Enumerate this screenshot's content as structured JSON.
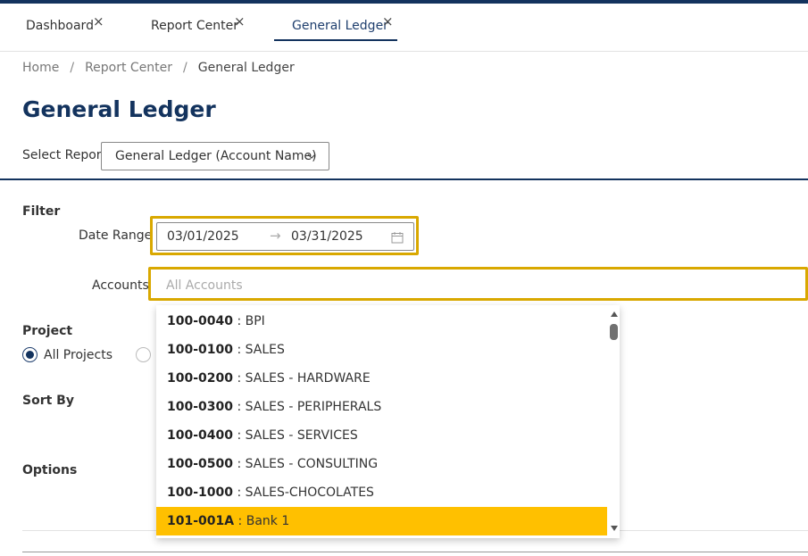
{
  "tabs": [
    {
      "label": "Dashboard"
    },
    {
      "label": "Report Center"
    },
    {
      "label": "General Ledger"
    }
  ],
  "close_glyph": "×",
  "breadcrumb": {
    "items": [
      "Home",
      "Report Center",
      "General Ledger"
    ],
    "separator": "/"
  },
  "page_title": "General Ledger",
  "report_select": {
    "label": "Select Report:",
    "value": "General Ledger (Account Name)"
  },
  "filter": {
    "heading": "Filter",
    "date_range": {
      "label": "Date Range :",
      "start": "03/01/2025",
      "end": "03/31/2025",
      "arrow": "→"
    },
    "accounts": {
      "label": "Accounts",
      "placeholder": "All Accounts"
    }
  },
  "project": {
    "heading": "Project",
    "options": [
      {
        "label": "All Projects",
        "selected": true
      }
    ]
  },
  "sort_by": {
    "heading": "Sort By"
  },
  "options_section": {
    "heading": "Options"
  },
  "accounts_dropdown": {
    "items": [
      {
        "code": "100-0040",
        "name": " : BPI"
      },
      {
        "code": "100-0100",
        "name": " : SALES"
      },
      {
        "code": "100-0200",
        "name": " : SALES - HARDWARE"
      },
      {
        "code": "100-0300",
        "name": " : SALES - PERIPHERALS"
      },
      {
        "code": "100-0400",
        "name": " : SALES - SERVICES"
      },
      {
        "code": "100-0500",
        "name": " : SALES - CONSULTING"
      },
      {
        "code": "100-1000",
        "name": " : SALES-CHOCOLATES"
      },
      {
        "code": "101-001A",
        "name": " : Bank 1"
      }
    ],
    "highlighted_index": 7
  },
  "colors": {
    "primary": "#13335e",
    "highlight": "#ffc000",
    "focus_outline": "#d9a800"
  },
  "icons": {
    "close": "close-icon",
    "dropdown": "chevron-down-icon",
    "calendar": "calendar-icon"
  }
}
